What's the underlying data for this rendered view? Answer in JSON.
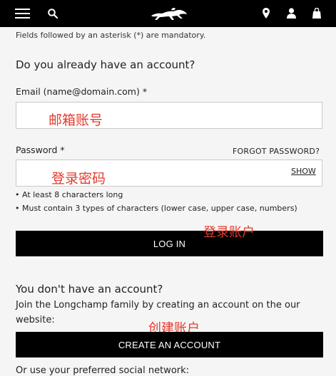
{
  "header": {
    "menu_icon": "hamburger-menu-icon",
    "search_icon": "search-icon",
    "logo": "longchamp-horse-logo",
    "store_icon": "map-pin-icon",
    "account_icon": "user-icon",
    "cart_icon": "shopping-bag-icon"
  },
  "form": {
    "mandatory_note": "Fields followed by an asterisk (*) are mandatory.",
    "login_heading": "Do you already have an account?",
    "email_label": "Email (name@domain.com) *",
    "email_value": "邮箱账号",
    "password_label": "Password *",
    "forgot_password": "FORGOT PASSWORD?",
    "password_value": "登录密码",
    "show_label": "SHOW",
    "rules": [
      "• At least 8 characters long",
      "• Must contain 3 types of characters (lower case, upper case, numbers)"
    ],
    "login_button": "LOG IN",
    "login_annotation": "登录账户"
  },
  "register": {
    "heading": "You don't have an account?",
    "description": "Join the Longchamp family by creating an account on the our website:",
    "create_button": "CREATE AN ACCOUNT",
    "create_annotation": "创建账户",
    "social_text": "Or use your preferred social network:"
  },
  "colors": {
    "header_bg": "#000000",
    "page_bg": "#f5f5f5",
    "annotation_red": "#e23b2e",
    "button_bg": "#000000"
  }
}
